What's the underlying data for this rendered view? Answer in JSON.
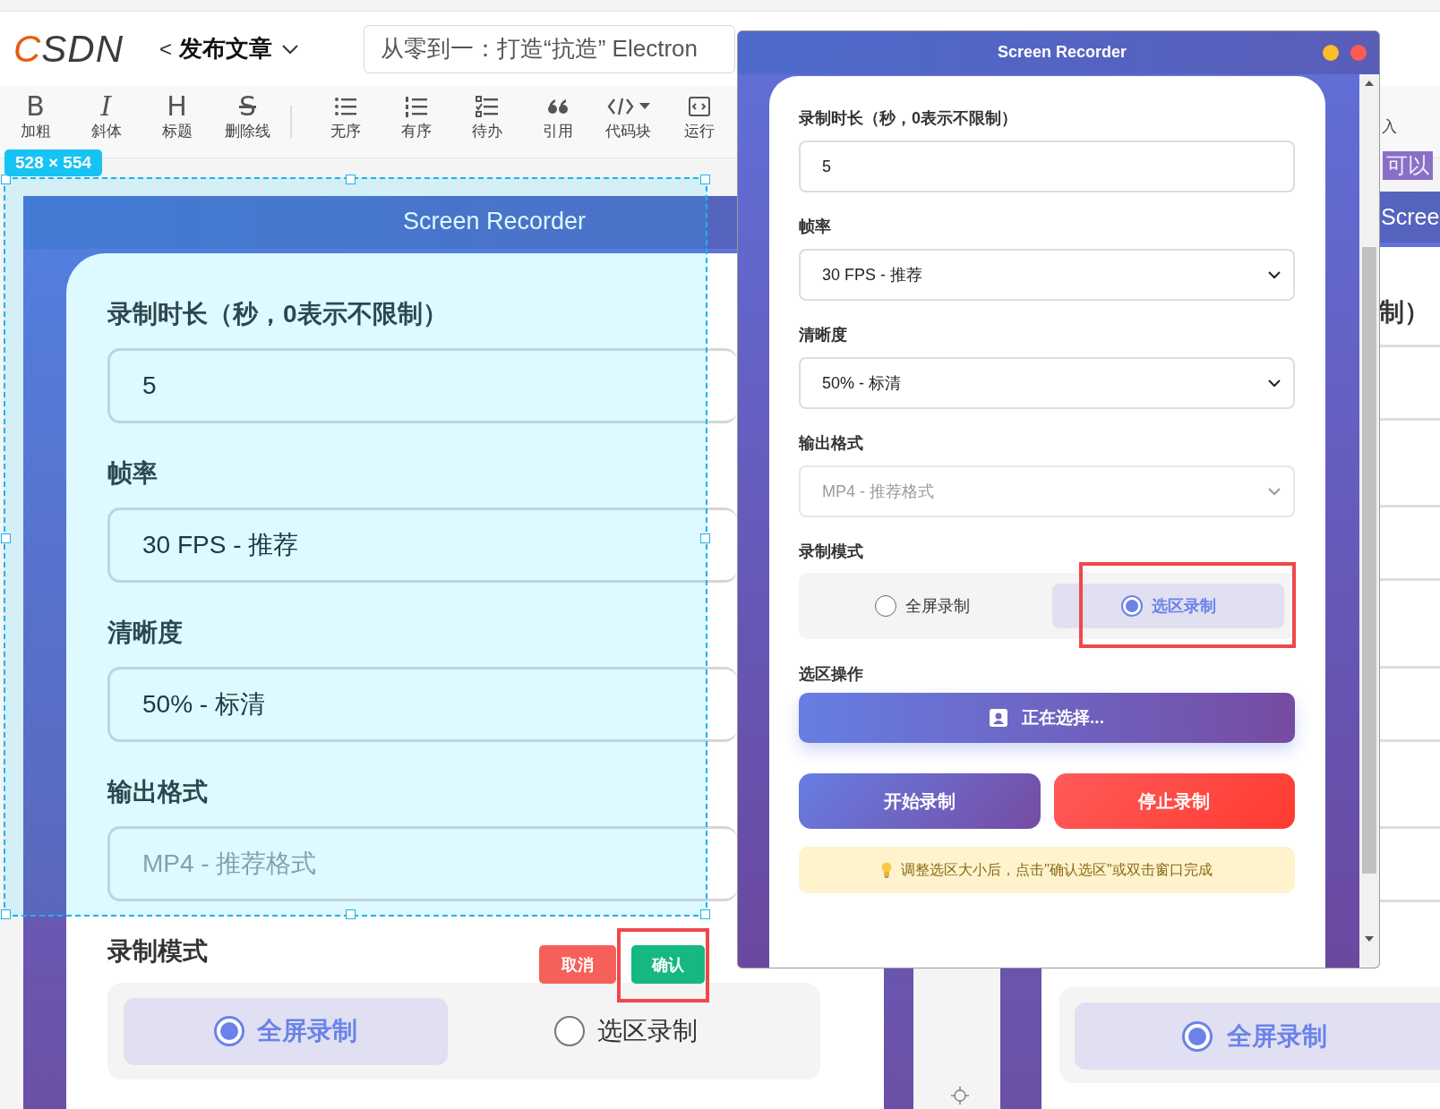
{
  "header": {
    "logo": "CSDN",
    "back": "<",
    "page_title": "发布文章",
    "article_title": "从零到一：打造“抗造” Electron"
  },
  "toolbar": [
    {
      "kind": "letter",
      "glyph": "B",
      "label": "加粗"
    },
    {
      "kind": "letter",
      "glyph": "I",
      "label": "斜体"
    },
    {
      "kind": "letter",
      "glyph": "H",
      "label": "标题"
    },
    {
      "kind": "letter",
      "glyph": "S",
      "label": "删除线"
    },
    {
      "kind": "bullets",
      "label": "无序"
    },
    {
      "kind": "numbers",
      "label": "有序"
    },
    {
      "kind": "todo",
      "label": "待办"
    },
    {
      "kind": "quote",
      "label": "引用"
    },
    {
      "kind": "code",
      "label": "代码块",
      "dropdown": true
    },
    {
      "kind": "run",
      "label": "运行"
    }
  ],
  "toolbar_right": [
    "入"
  ],
  "editor_snippet": "可以",
  "pasted_recorder": {
    "title": "Screen Recorder",
    "fields": [
      {
        "label": "录制时长（秒，0表示不限制）",
        "value": "5",
        "disabled": false
      },
      {
        "label": "帧率",
        "value": "30 FPS - 推荐",
        "disabled": false
      },
      {
        "label": "清晰度",
        "value": "50% - 标清",
        "disabled": false
      },
      {
        "label": "输出格式",
        "value": "MP4 - 推荐格式",
        "disabled": true
      }
    ],
    "mode_label": "录制模式",
    "modes": [
      {
        "label": "全屏录制",
        "selected": true
      },
      {
        "label": "选区录制",
        "selected": false
      }
    ]
  },
  "selection": {
    "size": "528 × 554",
    "cancel": "取消",
    "confirm": "确认"
  },
  "right_copy": {
    "title": "Scree",
    "label_fragment": "制）",
    "mode": {
      "label": "全屏录制",
      "selected": true
    }
  },
  "recorder_window": {
    "title": "Screen Recorder",
    "fields": [
      {
        "label": "录制时长（秒，0表示不限制）",
        "kind": "input",
        "value": "5",
        "disabled": false
      },
      {
        "label": "帧率",
        "kind": "select",
        "value": "30 FPS - 推荐",
        "disabled": false
      },
      {
        "label": "清晰度",
        "kind": "select",
        "value": "50% - 标清",
        "disabled": false
      },
      {
        "label": "输出格式",
        "kind": "select",
        "value": "MP4 - 推荐格式",
        "disabled": true
      }
    ],
    "mode_label": "录制模式",
    "modes": [
      {
        "label": "全屏录制",
        "selected": false
      },
      {
        "label": "选区录制",
        "selected": true
      }
    ],
    "area_label": "选区操作",
    "select_button": "正在选择...",
    "start_button": "开始录制",
    "stop_button": "停止录制",
    "tip": "调整选区大小后，点击\"确认选区\"或双击窗口完成"
  }
}
